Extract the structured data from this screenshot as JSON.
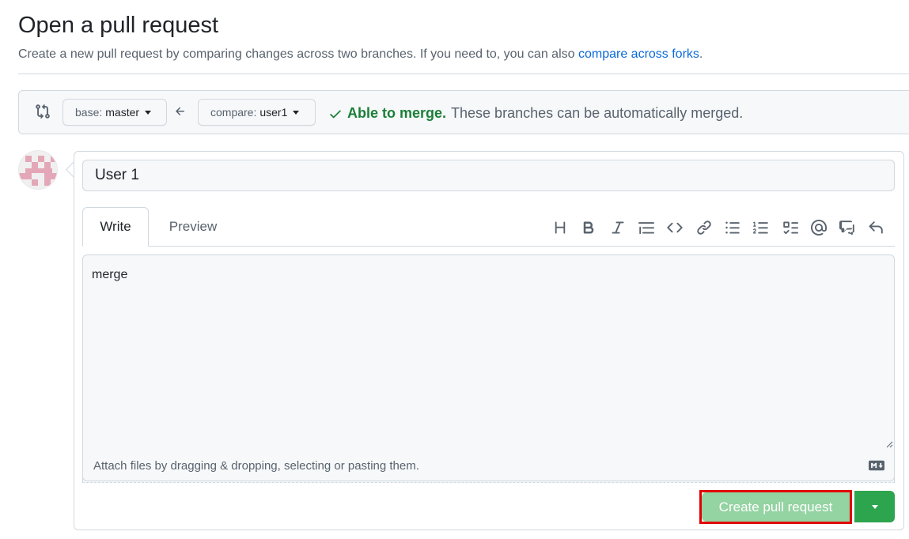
{
  "header": {
    "title": "Open a pull request",
    "subtitle_text": "Create a new pull request by comparing changes across two branches. If you need to, you can also ",
    "subtitle_link": "compare across forks",
    "subtitle_end": "."
  },
  "range": {
    "base_label": "base:",
    "base_value": "master",
    "compare_label": "compare:",
    "compare_value": "user1",
    "merge_ok": "Able to merge.",
    "merge_detail": "These branches can be automatically merged."
  },
  "form": {
    "title_value": "User 1",
    "tabs": {
      "write": "Write",
      "preview": "Preview"
    },
    "body_value": "merge",
    "attach_hint": "Attach files by dragging & dropping, selecting or pasting them.",
    "submit_label": "Create pull request"
  },
  "toolbar_icons": [
    "heading-icon",
    "bold-icon",
    "italic-icon",
    "quote-icon",
    "code-icon",
    "link-icon",
    "unordered-list-icon",
    "ordered-list-icon",
    "task-list-icon",
    "mention-icon",
    "cross-reference-icon",
    "reply-icon"
  ],
  "colors": {
    "link": "#0969da",
    "success": "#1a7f37",
    "primary_button": "#2da44e",
    "primary_button_disabled": "#94d3a2",
    "highlight_outline": "#e00000"
  }
}
